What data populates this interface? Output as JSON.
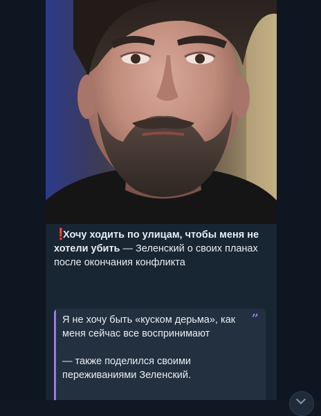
{
  "message": {
    "photo_alt_icon": "portrait-photo",
    "caption": {
      "emoji": "❗",
      "bold_text": "Хочу ходить по улицам, чтобы меня не хотели убить",
      "rest_text": " — Зеленский о своих планах после окончания конфликта"
    },
    "quote": {
      "line1": "Я не хочу быть «куском дерьма», как меня сейчас все воспринимают",
      "line2": "— также поделился своими переживаниями Зеленский.",
      "quote_icon": "quote-mark-icon"
    }
  },
  "colors": {
    "background": "#0e1621",
    "bubble": "#182533",
    "quote_accent": "#9f78e6",
    "emoji_red": "#e0243a",
    "text": "#e9edf1"
  }
}
